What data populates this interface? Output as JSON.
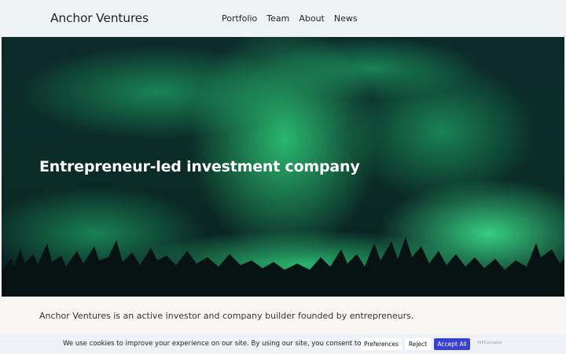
{
  "header": {
    "logo": "Anchor Ventures",
    "nav": [
      "Portfolio",
      "Team",
      "About",
      "News"
    ]
  },
  "hero": {
    "title": "Entrepreneur-led investment company"
  },
  "intro": {
    "text": "Anchor Ventures is an active investor and company builder founded by entrepreneurs."
  },
  "cookie_banner": {
    "text": "We use cookies to improve your experience on our site. By using our site, you consent to cookies.",
    "preferences_label": "Preferences",
    "reject_label": "Reject",
    "accept_label": "Accept All",
    "powered_by": "WPConsent"
  },
  "colors": {
    "accent": "#3a3fd6",
    "header_bg": "#f0f3f6",
    "cookie_bg": "#eef2f6"
  }
}
